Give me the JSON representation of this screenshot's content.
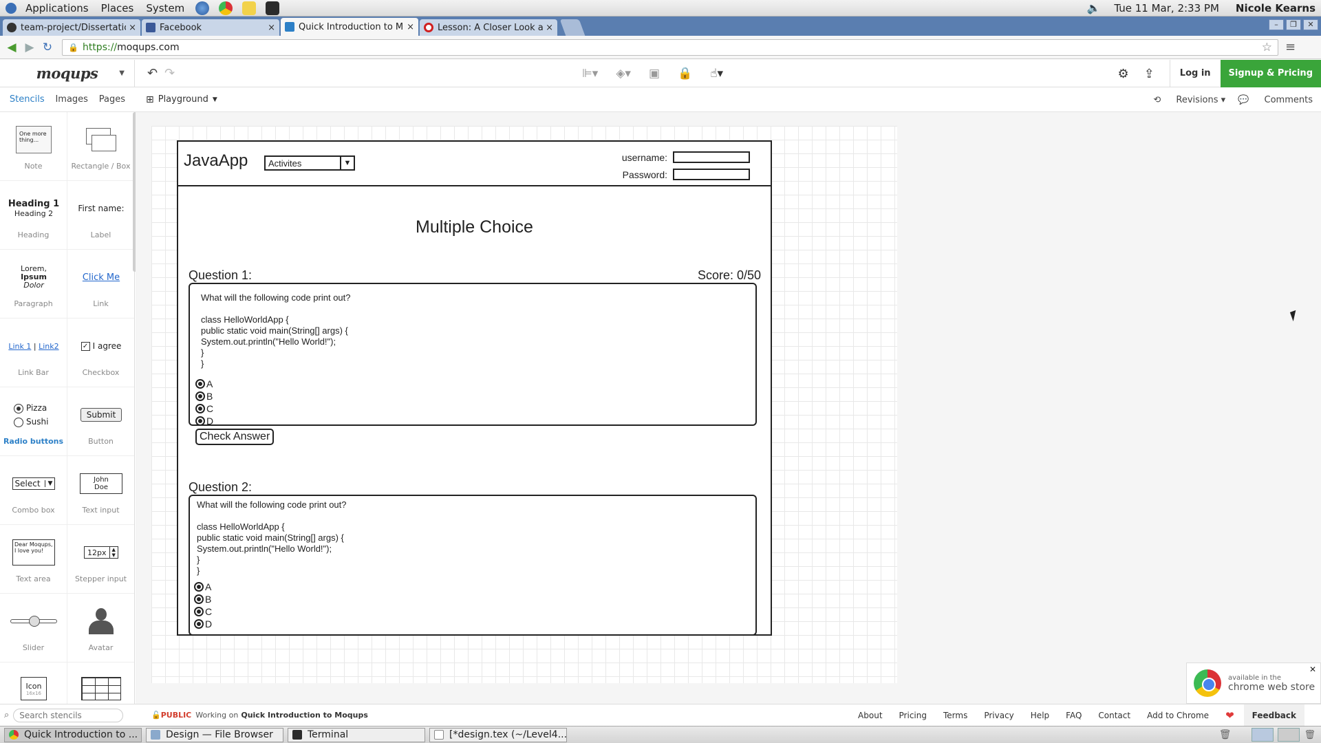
{
  "gnome_panel": {
    "menus": [
      "Applications",
      "Places",
      "System"
    ],
    "clock": "Tue 11 Mar,  2:33 PM",
    "user": "Nicole Kearns"
  },
  "tabs": [
    {
      "title": "team-project/Dissertatic",
      "active": false,
      "favicon": "github-icon"
    },
    {
      "title": "Facebook",
      "active": false,
      "favicon": "facebook-icon"
    },
    {
      "title": "Quick Introduction to M",
      "active": true,
      "favicon": "moqups-icon"
    },
    {
      "title": "Lesson: A Closer Look a",
      "active": false,
      "favicon": "oracle-icon"
    }
  ],
  "addressbar": {
    "url_scheme": "https://",
    "url_host": "moqups.com"
  },
  "toolbar": {
    "logo": "moqups",
    "login": "Log in",
    "signup": "Signup & Pricing"
  },
  "subbar": {
    "panel_tabs": [
      "Stencils",
      "Images",
      "Pages"
    ],
    "page": "Playground",
    "revisions": "Revisions",
    "comments": "Comments"
  },
  "stencils": [
    {
      "label": "Note",
      "preview": "One more thing..."
    },
    {
      "label": "Rectangle / Box",
      "preview": ""
    },
    {
      "label": "Heading",
      "preview": "Heading 1",
      "preview2": "Heading 2"
    },
    {
      "label": "Label",
      "preview": "First name:"
    },
    {
      "label": "Paragraph",
      "preview": "Lorem,",
      "preview2": "Ipsum",
      "preview3": "Dolor"
    },
    {
      "label": "Link",
      "preview": "Click Me"
    },
    {
      "label": "Link Bar",
      "preview": "Link 1",
      "preview2": "Link2"
    },
    {
      "label": "Checkbox",
      "preview": "I agree"
    },
    {
      "label": "Radio buttons",
      "preview": "Pizza",
      "preview2": "Sushi"
    },
    {
      "label": "Button",
      "preview": "Submit"
    },
    {
      "label": "Combo box",
      "preview": "Select"
    },
    {
      "label": "Text input",
      "preview": "John Doe"
    },
    {
      "label": "Text area",
      "preview": "Dear Moqups, I love you!"
    },
    {
      "label": "Stepper input",
      "preview": "12px"
    },
    {
      "label": "Slider",
      "preview": ""
    },
    {
      "label": "Avatar",
      "preview": ""
    },
    {
      "label": "",
      "preview": "Icon",
      "preview2": "16x16"
    },
    {
      "label": "",
      "preview": ""
    }
  ],
  "mockup": {
    "app_name": "JavaApp",
    "combo_value": "Activites",
    "username_label": "username:",
    "password_label": "Password:",
    "title": "Multiple Choice",
    "score": "Score: 0/50",
    "check_answer": "Check Answer",
    "questions": [
      {
        "label": "Question 1:",
        "lines": [
          "What will the following code print out?",
          "",
          "class HelloWorldApp {",
          "public static void main(String[] args) {",
          "System.out.println(\"Hello World!\");",
          "}",
          "}"
        ],
        "options": [
          "A",
          "B",
          "C",
          "D"
        ]
      },
      {
        "label": "Question 2:",
        "lines": [
          "What will the following code print out?",
          "",
          "class HelloWorldApp {",
          "public static void main(String[] args) {",
          "System.out.println(\"Hello World!\");",
          "}",
          "}"
        ],
        "options": [
          "A",
          "B",
          "C",
          "D"
        ]
      }
    ]
  },
  "chrome_store": {
    "line1": "available in the",
    "line2": "chrome web store"
  },
  "bottom_bar": {
    "search_placeholder": "Search stencils",
    "public": "PUBLIC",
    "working_on": "Working on",
    "project": "Quick Introduction to Moqups",
    "links": [
      "About",
      "Pricing",
      "Terms",
      "Privacy",
      "Help",
      "FAQ",
      "Contact",
      "Add to Chrome"
    ],
    "feedback": "Feedback"
  },
  "taskbar": [
    {
      "title": "Quick Introduction to ...",
      "active": true
    },
    {
      "title": "Design — File Browser",
      "active": false
    },
    {
      "title": "Terminal",
      "active": false
    },
    {
      "title": "[*design.tex (~/Level4...",
      "active": false
    }
  ],
  "colors": {
    "accent": "#2d80c7",
    "signup_green": "#3aa53a",
    "tabstrip_blue": "#5a7eb0",
    "public_red": "#d23c2c"
  }
}
